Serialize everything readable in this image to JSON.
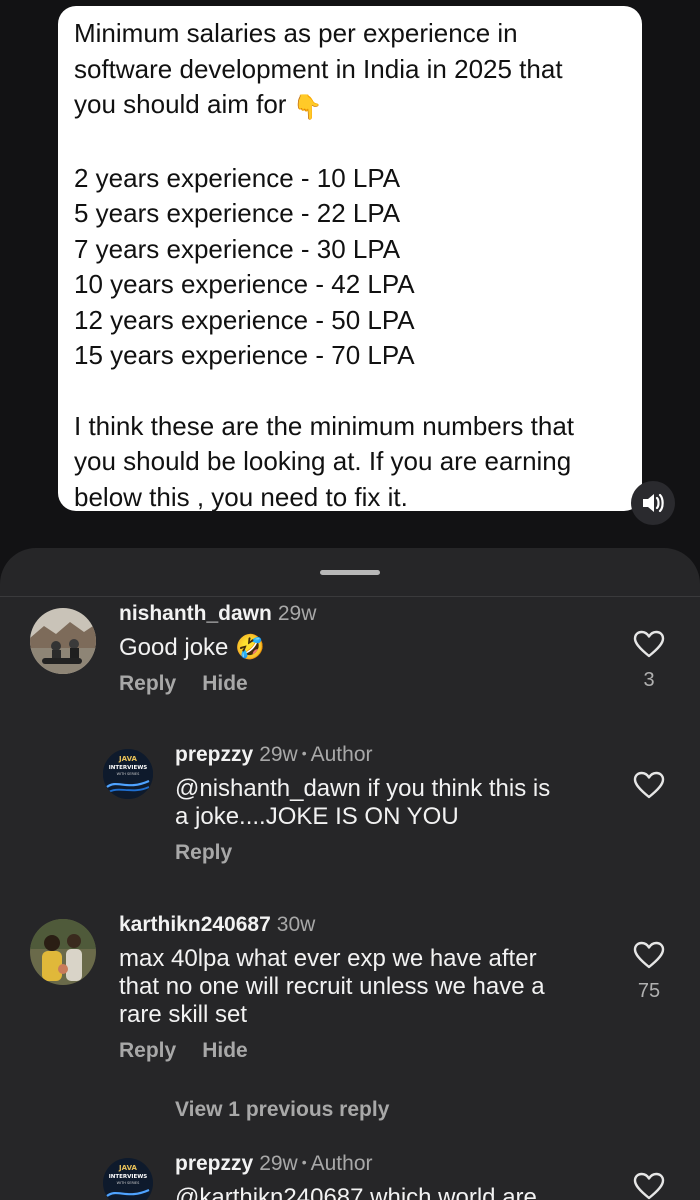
{
  "post": {
    "text_intro": "Minimum salaries as per experience in\nsoftware development in India in 2025 that\nyou should aim for",
    "emoji": "👇",
    "salary_lines": [
      "2 years experience - 10 LPA",
      "5 years experience - 22 LPA",
      "7 years experience - 30 LPA",
      "10 years experience - 42 LPA",
      "12 years experience - 50 LPA",
      "15 years experience - 70 LPA"
    ],
    "closing": "I think these are the minimum numbers that\nyou should be looking at. If you are earning\nbelow this , you need to fix it."
  },
  "comments": [
    {
      "username": "nishanth_dawn",
      "age": "29w",
      "text": "Good joke 🤣",
      "reply": "Reply",
      "hide": "Hide",
      "likes": "3"
    },
    {
      "username": "prepzzy",
      "age": "29w",
      "author_tag": "Author",
      "mention": "@nishanth_dawn",
      "text": " if you think this is\na joke....JOKE IS ON YOU",
      "reply": "Reply"
    },
    {
      "username": "karthikn240687",
      "age": "30w",
      "text": "max 40lpa what ever exp we have after\nthat no one will recruit unless we have a\nrare skill set",
      "reply": "Reply",
      "hide": "Hide",
      "likes": "75"
    },
    {
      "username": "prepzzy",
      "age": "29w",
      "author_tag": "Author",
      "partial_text": "@karthikn240687 which world are"
    }
  ],
  "view_previous": "View 1 previous reply",
  "avatar_badge": {
    "line1": "JAVA",
    "line2": "INTERVIEWS",
    "line3": "WITH SERIES"
  },
  "colors": {
    "sheet_bg": "#262628",
    "page_bg": "#121214",
    "muted": "#a8a8a8",
    "post_card": "#ffffff"
  }
}
